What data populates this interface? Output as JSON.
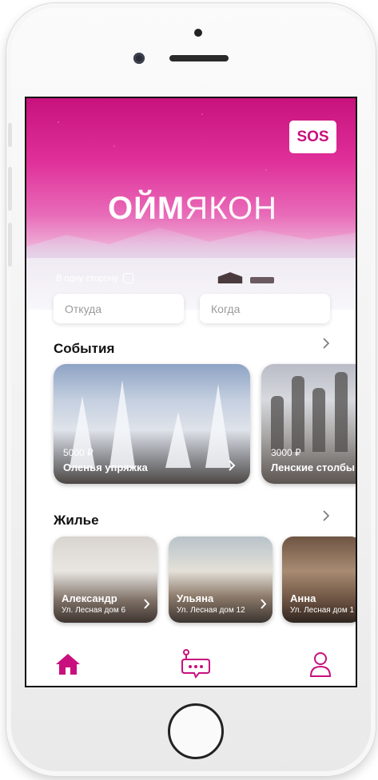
{
  "brand": {
    "accent": "#c90f7d",
    "hero_gradient_top": "#c7127c"
  },
  "hero": {
    "logo_bold": "ОЙМ",
    "logo_light": "ЯКОН",
    "sos_label": "SOS"
  },
  "search": {
    "oneway_label": "В одну сторону",
    "from_placeholder": "Откуда",
    "when_placeholder": "Когда"
  },
  "events": {
    "title": "События",
    "cards": [
      {
        "price": "5000 ₽",
        "name": "Оленья упряжка"
      },
      {
        "price": "3000 ₽",
        "name": "Ленские столбы"
      }
    ]
  },
  "housing": {
    "title": "Жилье",
    "cards": [
      {
        "name": "Александр",
        "address": "Ул. Лесная дом 6"
      },
      {
        "name": "Ульяна",
        "address": "Ул. Лесная дом 12"
      },
      {
        "name": "Анна",
        "address": "Ул. Лесная дом 1"
      }
    ]
  },
  "tabbar": {
    "items": [
      {
        "icon": "home-icon"
      },
      {
        "icon": "chat-bot-icon"
      },
      {
        "icon": "profile-icon"
      }
    ]
  }
}
